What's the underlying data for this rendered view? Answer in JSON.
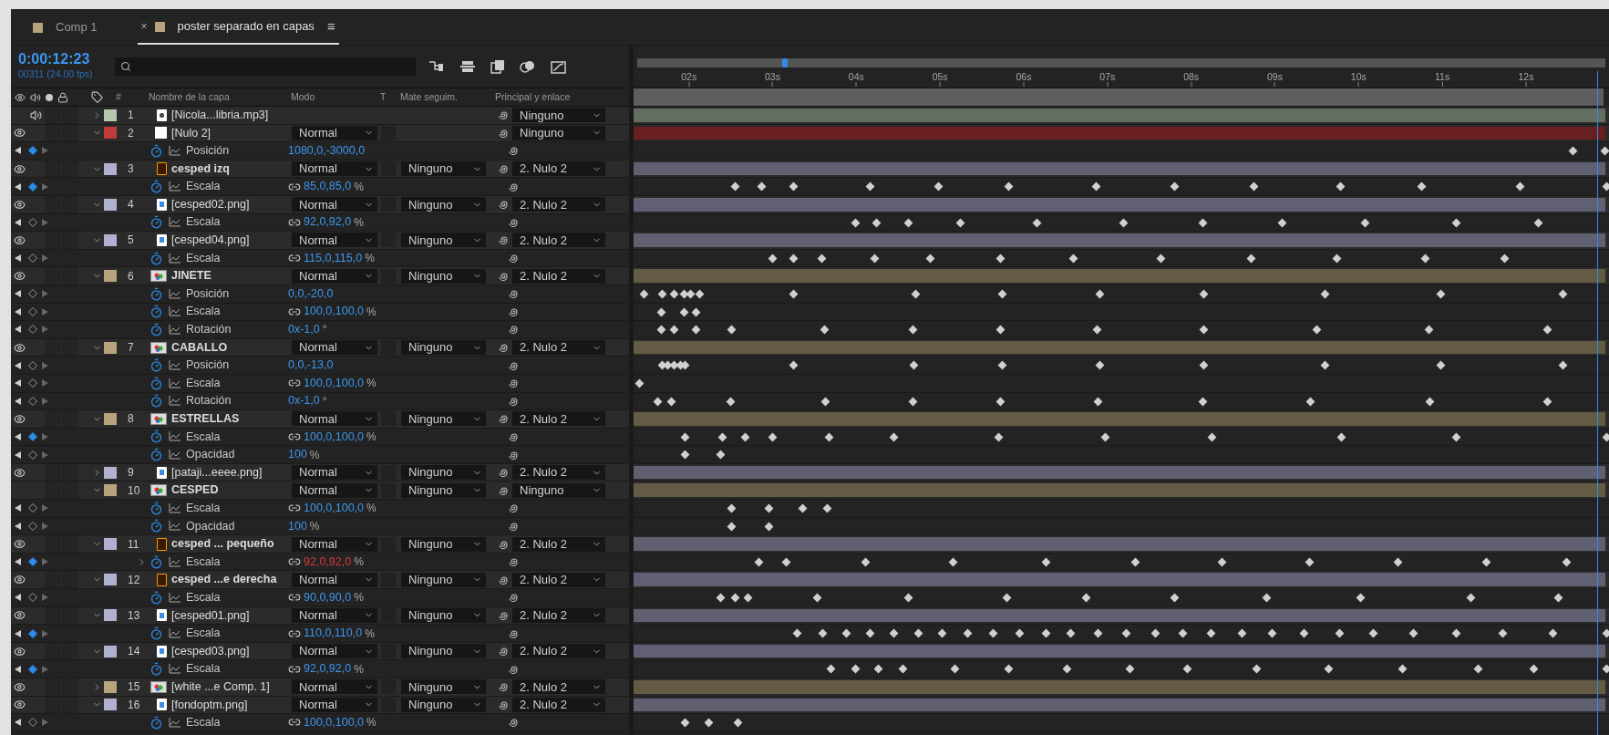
{
  "tabs": [
    {
      "label": "Comp 1",
      "selected": false,
      "color": "#b8a47c"
    },
    {
      "label": "poster separado en capas",
      "selected": true,
      "color": "#b8a47c",
      "close": "×",
      "menu": "≡"
    }
  ],
  "timecode": "0:00:12:23",
  "frame_info": "00311 (24.00 fps)",
  "columns": [
    "#",
    "Nombre de la capa",
    "Modo",
    "T",
    "Mate seguim.",
    "Principal y enlace"
  ],
  "ruler": [
    "02s",
    "03s",
    "04s",
    "05s",
    "06s",
    "07s",
    "08s",
    "09s",
    "10s",
    "11s",
    "12s"
  ],
  "layers": [
    {
      "number": "1",
      "name": "[Nicola...libria.mp3]",
      "kind": "audio",
      "color": "#b4c8b0",
      "visible": false,
      "audio": true,
      "expanded": false,
      "bold": false,
      "parent": "Ninguno"
    },
    {
      "number": "2",
      "name": "[Nulo 2]",
      "kind": "null",
      "color": "#c03a3a",
      "visible": true,
      "audio": false,
      "expanded": true,
      "bold": false,
      "mode": "Normal",
      "parent": "Ninguno",
      "properties": [
        {
          "name": "Posición",
          "value": "1080,0,-3000,0",
          "at_keyframe": true,
          "linked": false,
          "highlighted": false
        }
      ]
    },
    {
      "number": "3",
      "name": "cesped izq",
      "kind": "ai",
      "color": "#b0b0d0",
      "visible": true,
      "audio": false,
      "expanded": true,
      "bold": true,
      "mode": "Normal",
      "matte": "Ninguno",
      "parent": "2. Nulo 2",
      "properties": [
        {
          "name": "Escala",
          "value": "85,0,85,0",
          "unit": "%",
          "at_keyframe": true,
          "linked": true,
          "highlighted": false
        }
      ]
    },
    {
      "number": "4",
      "name": "[cesped02.png]",
      "kind": "png",
      "color": "#b0b0d0",
      "visible": true,
      "audio": false,
      "expanded": true,
      "bold": false,
      "mode": "Normal",
      "matte": "Ninguno",
      "parent": "2. Nulo 2",
      "properties": [
        {
          "name": "Escala",
          "value": "92,0,92,0",
          "unit": "%",
          "at_keyframe": false,
          "linked": true,
          "highlighted": false
        }
      ]
    },
    {
      "number": "5",
      "name": "[cesped04.png]",
      "kind": "png",
      "color": "#b0b0d0",
      "visible": true,
      "audio": false,
      "expanded": true,
      "bold": false,
      "mode": "Normal",
      "matte": "Ninguno",
      "parent": "2. Nulo 2",
      "properties": [
        {
          "name": "Escala",
          "value": "115,0,115,0",
          "unit": "%",
          "at_keyframe": false,
          "linked": true,
          "highlighted": false
        }
      ]
    },
    {
      "number": "6",
      "name": "JINETE",
      "kind": "comp",
      "color": "#b8a47c",
      "visible": true,
      "audio": false,
      "expanded": true,
      "bold": true,
      "mode": "Normal",
      "matte": "Ninguno",
      "parent": "2. Nulo 2",
      "properties": [
        {
          "name": "Posición",
          "value": "0,0,-20,0",
          "at_keyframe": false,
          "linked": false,
          "highlighted": false
        },
        {
          "name": "Escala",
          "value": "100,0,100,0",
          "unit": "%",
          "at_keyframe": false,
          "linked": true,
          "highlighted": false
        },
        {
          "name": "Rotación",
          "value": "0x-1,0",
          "unit": "°",
          "at_keyframe": false,
          "linked": false,
          "highlighted": false
        }
      ]
    },
    {
      "number": "7",
      "name": "CABALLO",
      "kind": "comp",
      "color": "#b8a47c",
      "visible": true,
      "audio": false,
      "expanded": true,
      "bold": true,
      "mode": "Normal",
      "matte": "Ninguno",
      "parent": "2. Nulo 2",
      "properties": [
        {
          "name": "Posición",
          "value": "0,0,-13,0",
          "at_keyframe": false,
          "linked": false,
          "highlighted": false
        },
        {
          "name": "Escala",
          "value": "100,0,100,0",
          "unit": "%",
          "at_keyframe": false,
          "linked": true,
          "highlighted": false
        },
        {
          "name": "Rotación",
          "value": "0x-1,0",
          "unit": "°",
          "at_keyframe": false,
          "linked": false,
          "highlighted": false
        }
      ]
    },
    {
      "number": "8",
      "name": "ESTRELLAS",
      "kind": "comp",
      "color": "#b8a47c",
      "visible": true,
      "audio": false,
      "expanded": true,
      "bold": true,
      "mode": "Normal",
      "matte": "Ninguno",
      "parent": "2. Nulo 2",
      "properties": [
        {
          "name": "Escala",
          "value": "100,0,100,0",
          "unit": "%",
          "at_keyframe": true,
          "linked": true,
          "highlighted": false
        },
        {
          "name": "Opacidad",
          "value": "100",
          "unit": "%",
          "at_keyframe": false,
          "linked": false,
          "highlighted": false
        }
      ]
    },
    {
      "number": "9",
      "name": "[pataji...eeee.png]",
      "kind": "png",
      "color": "#b0b0d0",
      "visible": true,
      "audio": false,
      "expanded": false,
      "bold": false,
      "mode": "Normal",
      "matte": "Ninguno",
      "parent": "2. Nulo 2"
    },
    {
      "number": "10",
      "name": "CESPED",
      "kind": "comp",
      "color": "#b8a47c",
      "visible": false,
      "audio": false,
      "expanded": true,
      "bold": true,
      "mode": "Normal",
      "matte": "Ninguno",
      "parent": "Ninguno",
      "properties": [
        {
          "name": "Escala",
          "value": "100,0,100,0",
          "unit": "%",
          "at_keyframe": false,
          "linked": true,
          "highlighted": false
        },
        {
          "name": "Opacidad",
          "value": "100",
          "unit": "%",
          "at_keyframe": false,
          "linked": false,
          "highlighted": false
        }
      ]
    },
    {
      "number": "11",
      "name": "cesped ... pequeño",
      "kind": "ai",
      "color": "#b0b0d0",
      "visible": true,
      "audio": false,
      "expanded": true,
      "bold": true,
      "mode": "Normal",
      "matte": "Ninguno",
      "parent": "2. Nulo 2",
      "properties": [
        {
          "name": "Escala",
          "value": "92,0,92,0",
          "unit": "%",
          "at_keyframe": true,
          "linked": true,
          "highlighted": true
        }
      ]
    },
    {
      "number": "12",
      "name": "cesped ...e derecha",
      "kind": "ai",
      "color": "#b0b0d0",
      "visible": true,
      "audio": false,
      "expanded": true,
      "bold": true,
      "mode": "Normal",
      "matte": "Ninguno",
      "parent": "2. Nulo 2",
      "properties": [
        {
          "name": "Escala",
          "value": "90,0,90,0",
          "unit": "%",
          "at_keyframe": false,
          "linked": true,
          "highlighted": false
        }
      ]
    },
    {
      "number": "13",
      "name": "[cesped01.png]",
      "kind": "png",
      "color": "#b0b0d0",
      "visible": true,
      "audio": false,
      "expanded": true,
      "bold": false,
      "mode": "Normal",
      "matte": "Ninguno",
      "parent": "2. Nulo 2",
      "properties": [
        {
          "name": "Escala",
          "value": "110,0,110,0",
          "unit": "%",
          "at_keyframe": true,
          "linked": true,
          "highlighted": false
        }
      ]
    },
    {
      "number": "14",
      "name": "[cesped03.png]",
      "kind": "png",
      "color": "#b0b0d0",
      "visible": true,
      "audio": false,
      "expanded": true,
      "bold": false,
      "mode": "Normal",
      "matte": "Ninguno",
      "parent": "2. Nulo 2",
      "properties": [
        {
          "name": "Escala",
          "value": "92,0,92,0",
          "unit": "%",
          "at_keyframe": true,
          "linked": true,
          "highlighted": false
        }
      ]
    },
    {
      "number": "15",
      "name": "[white ...e Comp. 1]",
      "kind": "comp",
      "color": "#b8a47c",
      "visible": true,
      "audio": false,
      "expanded": false,
      "bold": false,
      "mode": "Normal",
      "matte": "Ninguno",
      "parent": "2. Nulo 2"
    },
    {
      "number": "16",
      "name": "[fondoptm.png]",
      "kind": "png",
      "color": "#b0b0d0",
      "visible": true,
      "audio": false,
      "expanded": true,
      "bold": false,
      "mode": "Normal",
      "matte": "Ninguno",
      "parent": "2. Nulo 2",
      "properties": [
        {
          "name": "Escala",
          "value": "100,0,100,0",
          "unit": "%",
          "at_keyframe": false,
          "linked": true,
          "highlighted": false
        }
      ]
    }
  ]
}
